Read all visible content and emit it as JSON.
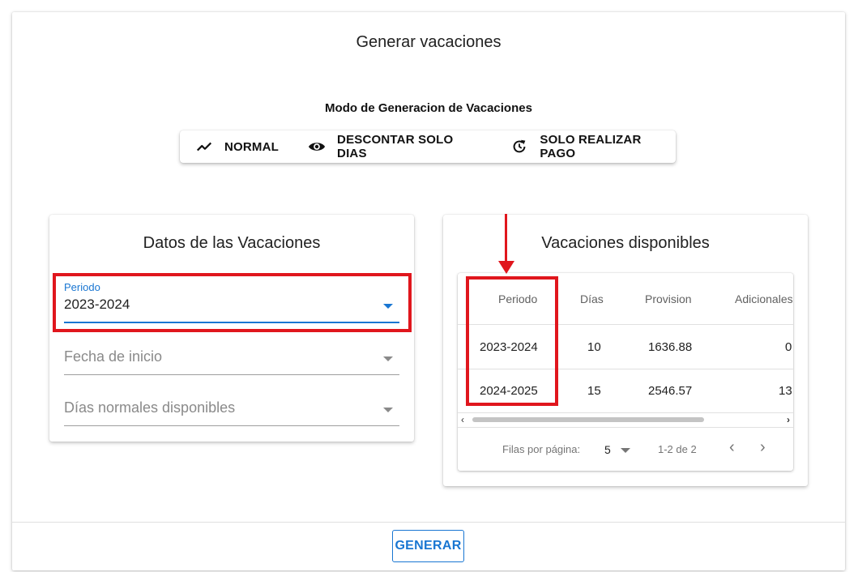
{
  "dialog": {
    "title": "Generar vacaciones",
    "generate_label": "GENERAR"
  },
  "mode": {
    "title": "Modo de Generacion de Vacaciones",
    "options": [
      {
        "label": "NORMAL",
        "icon": "trending-icon"
      },
      {
        "label": "DESCONTAR SOLO DIAS",
        "icon": "eye-icon"
      },
      {
        "label": "SOLO REALIZAR PAGO",
        "icon": "history-icon"
      }
    ]
  },
  "datos": {
    "title": "Datos de las Vacaciones",
    "periodo_label": "Periodo",
    "periodo_value": "2023-2024",
    "fecha_inicio_placeholder": "Fecha de inicio",
    "dias_placeholder": "Días normales disponibles"
  },
  "disponibles": {
    "title": "Vacaciones disponibles",
    "columns": [
      "Periodo",
      "Días",
      "Provision",
      "Adicionales"
    ],
    "rows": [
      [
        "2023-2024",
        "10",
        "1636.88",
        "0"
      ],
      [
        "2024-2025",
        "15",
        "2546.57",
        "13"
      ]
    ],
    "rows_per_page_label": "Filas por página:",
    "rows_per_page_value": "5",
    "range_text": "1-2 de 2"
  },
  "colors": {
    "accent": "#1976d2",
    "annotation": "#e0161d"
  }
}
